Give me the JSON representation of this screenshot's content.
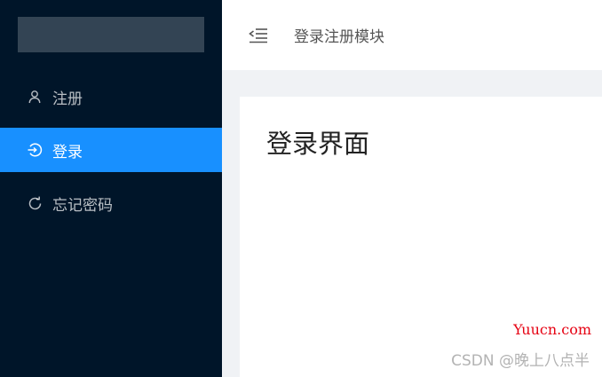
{
  "sidebar": {
    "items": [
      {
        "label": "注册",
        "icon": "user-icon",
        "active": false
      },
      {
        "label": "登录",
        "icon": "login-icon",
        "active": true
      },
      {
        "label": "忘记密码",
        "icon": "reload-icon",
        "active": false
      }
    ]
  },
  "header": {
    "title": "登录注册模块"
  },
  "content": {
    "title": "登录界面"
  },
  "watermark": {
    "site": "Yuucn.com",
    "csdn": "CSDN @晚上八点半"
  },
  "colors": {
    "sidebar_bg": "#001529",
    "active_bg": "#1890ff",
    "content_bg": "#f0f2f5",
    "watermark_red": "#e60012"
  }
}
